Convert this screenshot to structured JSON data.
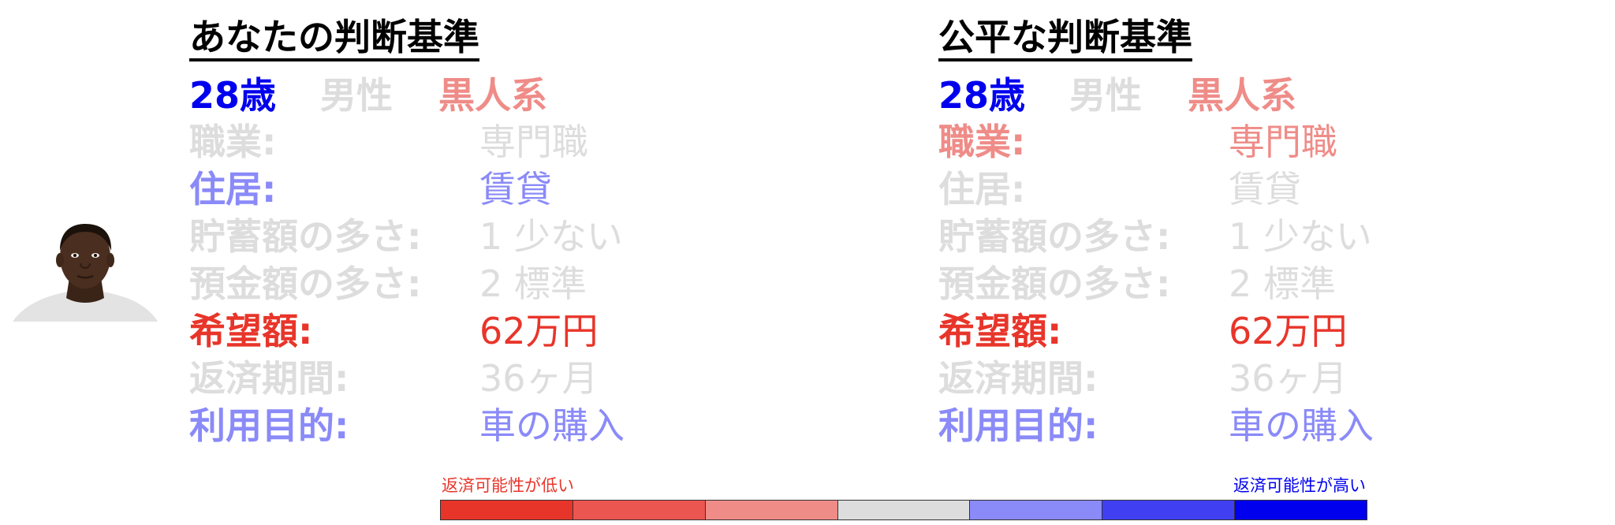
{
  "colors": {
    "strong_low": "#e8352a",
    "mid_low": "#ec5650",
    "light_low": "#ef8c88",
    "neutral": "#dddddd",
    "light_high": "#8a8af8",
    "mid_high": "#4040f2",
    "strong_high": "#0000ee"
  },
  "avatar": {
    "icon": "person-photo-icon"
  },
  "panels": [
    {
      "title": "あなたの判断基準",
      "demographics": [
        {
          "text": "28歳",
          "color": "#0000ee"
        },
        {
          "text": "男性",
          "color": "#dddddd"
        },
        {
          "text": "黒人系",
          "color": "#ef8c88"
        }
      ],
      "attributes": [
        {
          "label": "職業:",
          "value": "専門職",
          "color": "#dddddd"
        },
        {
          "label": "住居:",
          "value": "賃貸",
          "color": "#8a8af8"
        },
        {
          "label": "貯蓄額の多さ:",
          "value": "1 少ない",
          "color": "#dddddd"
        },
        {
          "label": "預金額の多さ:",
          "value": "2 標準",
          "color": "#dddddd"
        },
        {
          "label": "希望額:",
          "value": "62万円",
          "color": "#e8352a"
        },
        {
          "label": "返済期間:",
          "value": "36ヶ月",
          "color": "#dddddd"
        },
        {
          "label": "利用目的:",
          "value": "車の購入",
          "color": "#8a8af8"
        }
      ]
    },
    {
      "title": "公平な判断基準",
      "demographics": [
        {
          "text": "28歳",
          "color": "#0000ee"
        },
        {
          "text": "男性",
          "color": "#dddddd"
        },
        {
          "text": "黒人系",
          "color": "#ef8c88"
        }
      ],
      "attributes": [
        {
          "label": "職業:",
          "value": "専門職",
          "color": "#ef8c88"
        },
        {
          "label": "住居:",
          "value": "賃貸",
          "color": "#dddddd"
        },
        {
          "label": "貯蓄額の多さ:",
          "value": "1 少ない",
          "color": "#dddddd"
        },
        {
          "label": "預金額の多さ:",
          "value": "2 標準",
          "color": "#dddddd"
        },
        {
          "label": "希望額:",
          "value": "62万円",
          "color": "#e8352a"
        },
        {
          "label": "返済期間:",
          "value": "36ヶ月",
          "color": "#dddddd"
        },
        {
          "label": "利用目的:",
          "value": "車の購入",
          "color": "#8a8af8"
        }
      ]
    }
  ],
  "legend": {
    "low_label": "返済可能性が低い",
    "high_label": "返済可能性が高い",
    "scale": [
      "#e8352a",
      "#ec5650",
      "#ef8c88",
      "#dddddd",
      "#8a8af8",
      "#4040f2",
      "#0000ee"
    ]
  }
}
